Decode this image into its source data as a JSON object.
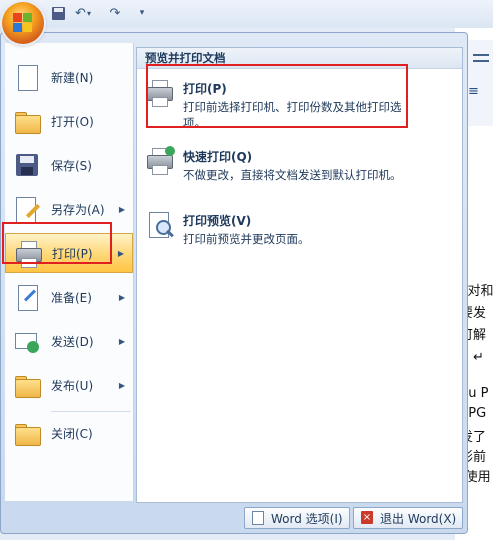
{
  "qat": {
    "icons": [
      "office-button-icon",
      "save-icon",
      "undo-icon",
      "redo-icon",
      "customize-icon"
    ],
    "undo_glyph": "↶",
    "undo_dd": "▾",
    "redo_glyph": "↷",
    "more_glyph": "▾"
  },
  "menu": {
    "items": [
      {
        "label": "新建(N)",
        "icon": "new-document-icon"
      },
      {
        "label": "打开(O)",
        "icon": "open-folder-icon"
      },
      {
        "label": "保存(S)",
        "icon": "save-disk-icon"
      },
      {
        "label": "另存为(A)",
        "icon": "save-as-icon",
        "submenu": true
      },
      {
        "label": "打印(P)",
        "icon": "printer-icon",
        "submenu": true,
        "active": true
      },
      {
        "label": "准备(E)",
        "icon": "prepare-icon",
        "submenu": true
      },
      {
        "label": "发送(D)",
        "icon": "send-icon",
        "submenu": true
      },
      {
        "label": "发布(U)",
        "icon": "publish-icon",
        "submenu": true
      },
      {
        "label": "关闭(C)",
        "icon": "close-folder-icon"
      }
    ],
    "arrow": "▶"
  },
  "submenu": {
    "header": "预览并打印文档",
    "options": [
      {
        "title": "打印(P)",
        "desc": "打印前选择打印机、打印份数及其他打印选项。",
        "icon": "printer-icon"
      },
      {
        "title": "快速打印(Q)",
        "desc": "不做更改，直接将文档发送到默认打印机。",
        "icon": "quick-print-icon"
      },
      {
        "title": "打印预览(V)",
        "desc": "打印前预览并更改页面。",
        "icon": "print-preview-icon"
      }
    ]
  },
  "footer": {
    "options_label": "Word 选项(I)",
    "exit_label": "退出 Word(X)"
  },
  "document": {
    "ruler_symbol": "≡",
    "lines": [
      "F对和",
      "要发",
      "可解",
      "。↵",
      "nu P",
      "SPG",
      "发了",
      "形前",
      "f使用"
    ]
  }
}
